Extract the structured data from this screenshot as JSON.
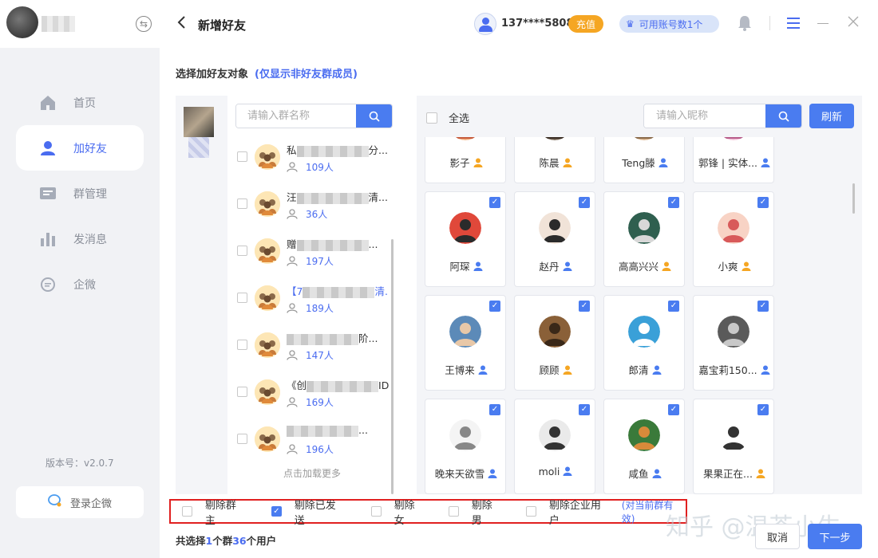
{
  "sidebar": {
    "items": [
      {
        "label": "首页",
        "icon": "home-icon"
      },
      {
        "label": "加好友",
        "icon": "user-icon"
      },
      {
        "label": "群管理",
        "icon": "group-manage-icon"
      },
      {
        "label": "发消息",
        "icon": "bar-chart-icon"
      },
      {
        "label": "企微",
        "icon": "chat-bubble-icon"
      }
    ],
    "version": "版本号：v2.0.7",
    "login_label": "登录企微"
  },
  "header": {
    "title": "新增好友",
    "phone": "137****5808",
    "recharge_label": "充值",
    "accounts_label": "可用账号数1个"
  },
  "main": {
    "select_label": "选择加好友对象",
    "select_hint": "(仅显示非好友群成员)",
    "group_search_placeholder": "请输入群名称",
    "groups": [
      {
        "name_prefix": "私",
        "name_suffix": "分...",
        "count": "109人"
      },
      {
        "name_prefix": "汪",
        "name_suffix": "清...",
        "count": "36人"
      },
      {
        "name_prefix": "赠",
        "name_suffix": "...",
        "count": "197人"
      },
      {
        "name_prefix": "【7",
        "name_suffix": "清...",
        "count": "189人"
      },
      {
        "name_prefix": "",
        "name_suffix": "阶...",
        "count": "147人"
      },
      {
        "name_prefix": "《创",
        "name_suffix": "ID...",
        "count": "169人"
      },
      {
        "name_prefix": "",
        "name_suffix": "...",
        "count": "196人"
      }
    ],
    "load_more": "点击加载更多",
    "select_all": "全选",
    "nickname_placeholder": "请输入昵称",
    "refresh_label": "刷新",
    "friends": [
      {
        "name": "影子",
        "gender_color": "#f5a623",
        "checked": false
      },
      {
        "name": "陈晨",
        "gender_color": "#f5a623",
        "checked": false
      },
      {
        "name": "Teng滕",
        "gender_color": "#4a7cf0",
        "checked": false
      },
      {
        "name": "郭锋 | 实体...",
        "gender_color": "#4a7cf0",
        "checked": false
      },
      {
        "name": "阿琛",
        "gender_color": "#4a7cf0",
        "checked": true
      },
      {
        "name": "赵丹",
        "gender_color": "#4a7cf0",
        "checked": true
      },
      {
        "name": "高高兴兴",
        "gender_color": "#f5a623",
        "checked": true
      },
      {
        "name": "小爽",
        "gender_color": "#f5a623",
        "checked": true
      },
      {
        "name": "王博来",
        "gender_color": "#4a7cf0",
        "checked": true
      },
      {
        "name": "顾顾",
        "gender_color": "#f5a623",
        "checked": true
      },
      {
        "name": "郎清",
        "gender_color": "#4a7cf0",
        "checked": true
      },
      {
        "name": "嘉宝莉150...",
        "gender_color": "#4a7cf0",
        "checked": true
      },
      {
        "name": "晚来天欲雪",
        "gender_color": "#4a7cf0",
        "checked": true
      },
      {
        "name": "moli",
        "gender_color": "#4a7cf0",
        "checked": true
      },
      {
        "name": "咸鱼",
        "gender_color": "#4a7cf0",
        "checked": true
      },
      {
        "name": "果果正在...",
        "gender_color": "#f5a623",
        "checked": true
      }
    ],
    "filters": [
      {
        "label": "剔除群主",
        "checked": false
      },
      {
        "label": "剔除已发送",
        "checked": true
      },
      {
        "label": "剔除女",
        "checked": false
      },
      {
        "label": "剔除男",
        "checked": false
      },
      {
        "label": "剔除企业用户",
        "checked": false
      }
    ],
    "filter_note": "(对当前群有效)",
    "summary": {
      "prefix": "共选择",
      "groups": "1",
      "mid": "个群",
      "users": "36",
      "suffix": "个用户"
    },
    "cancel_label": "取消",
    "next_label": "下一步",
    "watermark": "知乎 @温茶小生"
  },
  "colors": {
    "accent": "#4a7cf0",
    "orange": "#f5a623",
    "filter_border": "#e02020"
  }
}
